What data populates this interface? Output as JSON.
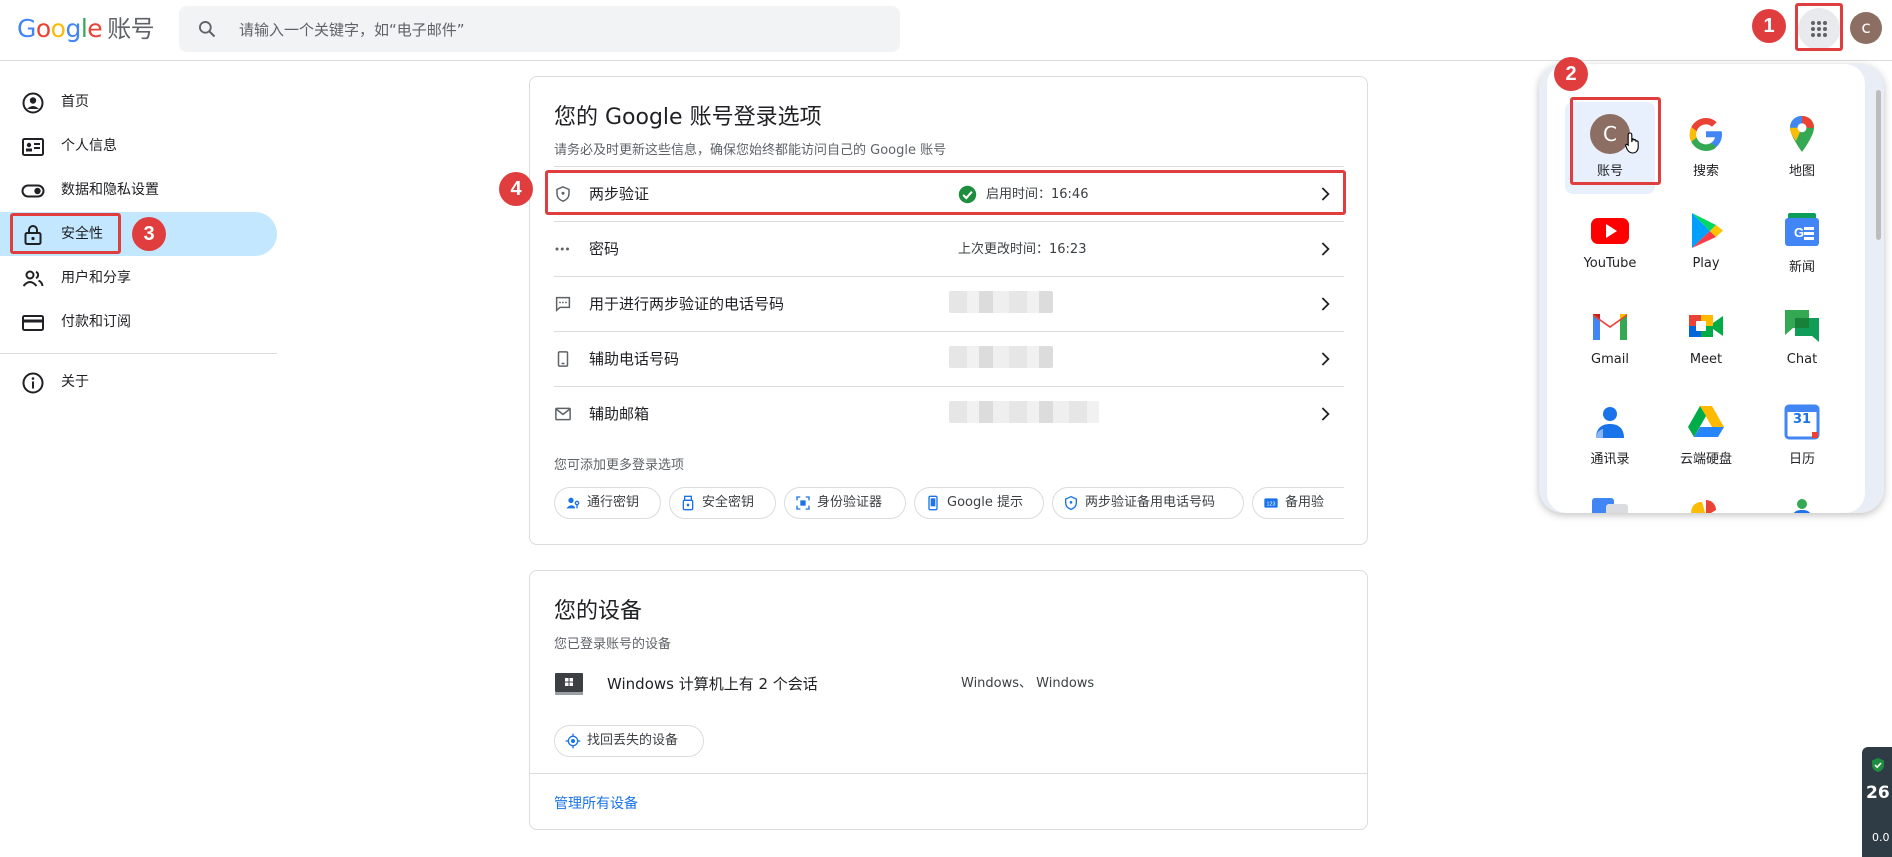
{
  "header": {
    "brand_letters": [
      "G",
      "o",
      "o",
      "g",
      "l",
      "e"
    ],
    "product": "账号",
    "search_placeholder": "请输入一个关键字，如“电子邮件”",
    "avatar_letter": "c"
  },
  "annotations": {
    "n1": "1",
    "n2": "2",
    "n3": "3",
    "n4": "4"
  },
  "sidebar": {
    "items": [
      {
        "label": "首页",
        "icon": "person-circle-icon"
      },
      {
        "label": "个人信息",
        "icon": "id-card-icon"
      },
      {
        "label": "数据和隐私设置",
        "icon": "toggle-icon"
      },
      {
        "label": "安全性",
        "icon": "lock-icon"
      },
      {
        "label": "用户和分享",
        "icon": "people-icon"
      },
      {
        "label": "付款和订阅",
        "icon": "credit-card-icon"
      },
      {
        "label": "关于",
        "icon": "info-icon"
      }
    ]
  },
  "signin": {
    "title": "您的 Google 账号登录选项",
    "subtitle": "请务必及时更新这些信息，确保您始终都能访问自己的 Google 账号",
    "rows": [
      {
        "title": "两步验证",
        "status": "启用时间：16:46",
        "icon": "shield-icon"
      },
      {
        "title": "密码",
        "status": "上次更改时间：16:23",
        "icon": "password-dots-icon"
      },
      {
        "title": "用于进行两步验证的电话号码",
        "status": "",
        "icon": "message-icon"
      },
      {
        "title": "辅助电话号码",
        "status": "",
        "icon": "phone-icon"
      },
      {
        "title": "辅助邮箱",
        "status": "",
        "icon": "mail-icon"
      }
    ],
    "more_label": "您可添加更多登录选项",
    "chips": [
      {
        "label": "通行密钥",
        "icon": "passkey-icon"
      },
      {
        "label": "安全密钥",
        "icon": "security-key-icon"
      },
      {
        "label": "身份验证器",
        "icon": "authenticator-icon"
      },
      {
        "label": "Google 提示",
        "icon": "phone-prompt-icon"
      },
      {
        "label": "两步验证备用电话号码",
        "icon": "shield-icon"
      },
      {
        "label": "备用验",
        "icon": "backup-codes-icon"
      }
    ]
  },
  "devices": {
    "title": "您的设备",
    "subtitle": "您已登录账号的设备",
    "device_title": "Windows 计算机上有 2 个会话",
    "device_status": "Windows、 Windows",
    "find_device": "找回丢失的设备",
    "manage": "管理所有设备"
  },
  "apps": [
    {
      "label": "账号",
      "icon": "account-avatar-icon"
    },
    {
      "label": "搜索",
      "icon": "google-search-icon"
    },
    {
      "label": "地图",
      "icon": "maps-icon"
    },
    {
      "label": "YouTube",
      "icon": "youtube-icon"
    },
    {
      "label": "Play",
      "icon": "play-icon"
    },
    {
      "label": "新闻",
      "icon": "news-icon"
    },
    {
      "label": "Gmail",
      "icon": "gmail-icon"
    },
    {
      "label": "Meet",
      "icon": "meet-icon"
    },
    {
      "label": "Chat",
      "icon": "chat-icon"
    },
    {
      "label": "通讯录",
      "icon": "contacts-icon"
    },
    {
      "label": "云端硬盘",
      "icon": "drive-icon"
    },
    {
      "label": "日历",
      "icon": "calendar-icon"
    }
  ],
  "app_avatar_letter": "C",
  "calendar_day": "31",
  "widget": {
    "value": "26",
    "sub": "0.0"
  }
}
